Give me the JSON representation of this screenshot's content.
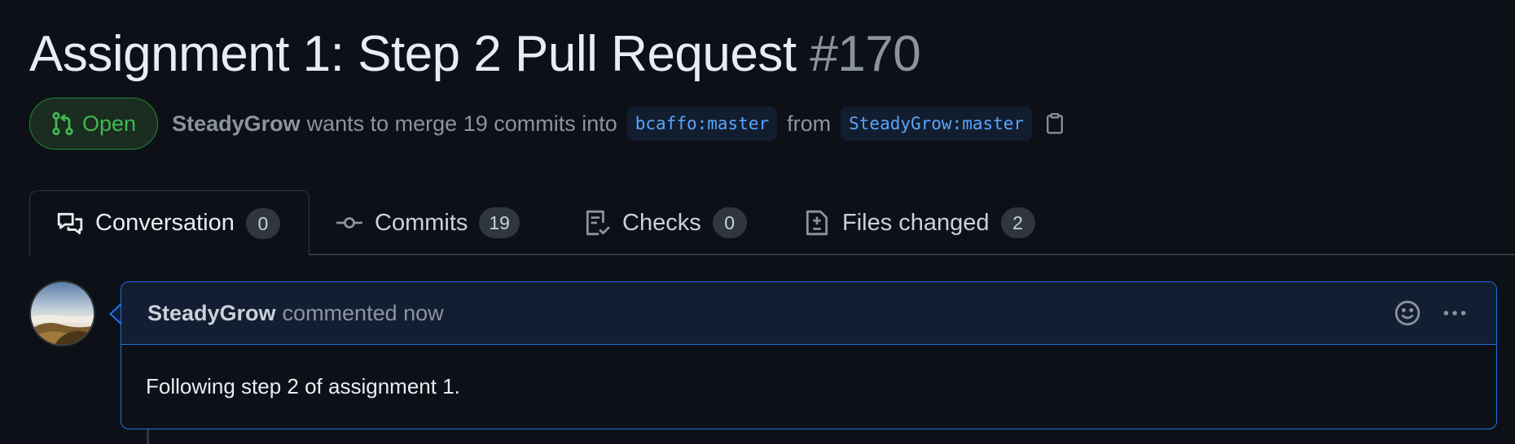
{
  "pr": {
    "title": "Assignment 1: Step 2 Pull Request",
    "number": "#170",
    "state": "Open",
    "author": "SteadyGrow",
    "merge_text": "wants to merge 19 commits into",
    "base_branch": "bcaffo:master",
    "from_text": "from",
    "head_branch": "SteadyGrow:master"
  },
  "tabs": [
    {
      "label": "Conversation",
      "count": "0",
      "icon": "comment-discussion-icon"
    },
    {
      "label": "Commits",
      "count": "19",
      "icon": "git-commit-icon"
    },
    {
      "label": "Checks",
      "count": "0",
      "icon": "checklist-icon"
    },
    {
      "label": "Files changed",
      "count": "2",
      "icon": "file-diff-icon"
    }
  ],
  "comment": {
    "author": "SteadyGrow",
    "action": "commented now",
    "body": "Following step 2 of assignment 1."
  },
  "colors": {
    "background": "#0d1117",
    "open_green": "#3fb950",
    "branch_blue": "#58a6ff",
    "comment_border": "#1f6feb"
  }
}
